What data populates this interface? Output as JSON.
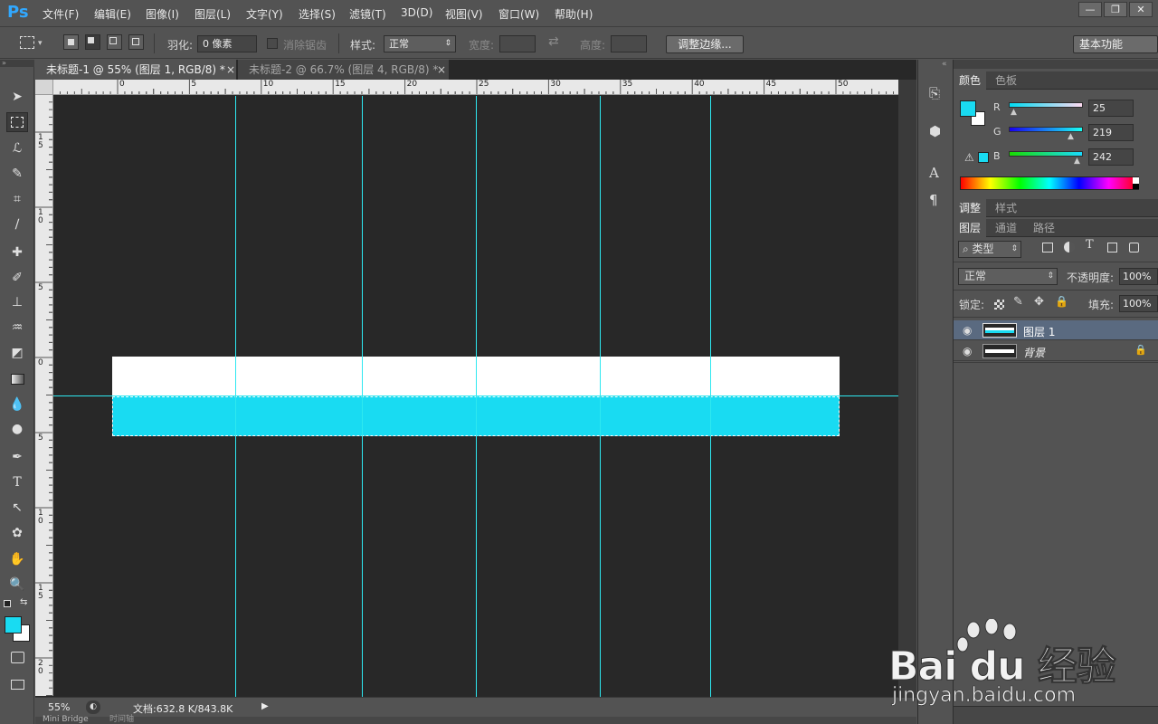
{
  "app": {
    "logo": "Ps",
    "menu": [
      "文件(F)",
      "编辑(E)",
      "图像(I)",
      "图层(L)",
      "文字(Y)",
      "选择(S)",
      "滤镜(T)",
      "3D(D)",
      "视图(V)",
      "窗口(W)",
      "帮助(H)"
    ],
    "window_controls": [
      "—",
      "❐",
      "✕"
    ]
  },
  "options": {
    "feather_label": "羽化:",
    "feather_value": "0 像素",
    "antialias_label": "消除锯齿",
    "style_label": "样式:",
    "style_value": "正常",
    "width_label": "宽度:",
    "height_label": "高度:",
    "refine_edge_button": "调整边缘...",
    "workspace_value": "基本功能"
  },
  "documents": {
    "tabs": [
      {
        "label": "未标题-1 @ 55% (图层 1, RGB/8) *",
        "close": "×"
      },
      {
        "label": "未标题-2 @ 66.7% (图层 4, RGB/8) *",
        "close": "×"
      }
    ],
    "ruler_h_labels": [
      "0",
      "5",
      "10",
      "15",
      "20",
      "25",
      "30",
      "35",
      "40",
      "45",
      "50"
    ],
    "ruler_v_labels": [
      "1 5",
      "1 0",
      "5",
      "0",
      "5",
      "1 0",
      "1 5",
      "2 0"
    ]
  },
  "status": {
    "zoom": "55%",
    "doc_info": "文档:632.8 K/843.8K",
    "bottom_tabs": [
      "Mini Bridge",
      "时间轴"
    ]
  },
  "color_panel": {
    "tabs": [
      "颜色",
      "色板"
    ],
    "foreground": "#19dbf2",
    "background": "#ffffff",
    "channels": [
      {
        "label": "R",
        "value": "25"
      },
      {
        "label": "G",
        "value": "219"
      },
      {
        "label": "B",
        "value": "242"
      }
    ]
  },
  "adjust_panel": {
    "tabs": [
      "调整",
      "样式"
    ]
  },
  "layers_panel": {
    "tabs": [
      "图层",
      "通道",
      "路径"
    ],
    "filter_value": "类型",
    "blend_mode": "正常",
    "opacity_label": "不透明度:",
    "opacity_value": "100%",
    "lock_label": "锁定:",
    "fill_label": "填充:",
    "fill_value": "100%",
    "layers": [
      {
        "name": "图层 1",
        "selected": true
      },
      {
        "name": "背景",
        "selected": false
      }
    ]
  },
  "watermark": {
    "brand": "Bai du 经验",
    "url": "jingyan.baidu.com"
  },
  "colors": {
    "cyan": "#19dbf2",
    "guide": "#2ee8f0",
    "panel": "#535353",
    "canvas": "#282828"
  }
}
